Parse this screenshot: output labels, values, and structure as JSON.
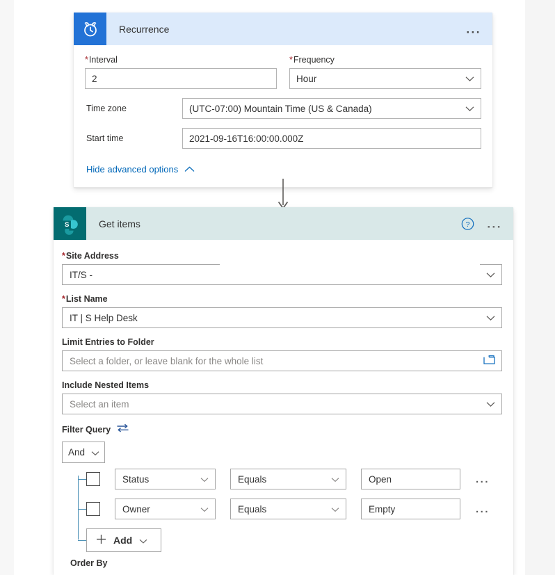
{
  "recurrence": {
    "title": "Recurrence",
    "icon": "alarm-clock-icon",
    "menu_label": "...",
    "fields": {
      "interval_label": "Interval",
      "interval_value": "2",
      "frequency_label": "Frequency",
      "frequency_value": "Hour",
      "timezone_label": "Time zone",
      "timezone_value": "(UTC-07:00) Mountain Time (US & Canada)",
      "starttime_label": "Start time",
      "starttime_value": "2021-09-16T16:00:00.000Z"
    },
    "advanced_link": "Hide advanced options",
    "required_marker": "*"
  },
  "getitems": {
    "title": "Get items",
    "icon": "sharepoint-icon",
    "help_label": "?",
    "menu_label": "...",
    "site_address_label": "Site Address",
    "site_address_value": "IT/S -",
    "list_name_label": "List Name",
    "list_name_value": "IT | S Help Desk",
    "limit_folder_label": "Limit Entries to Folder",
    "limit_folder_placeholder": "Select a folder, or leave blank for the whole list",
    "folder_icon": "folder-picker-icon",
    "nested_items_label": "Include Nested Items",
    "nested_items_placeholder": "Select an item",
    "filter_query_label": "Filter Query",
    "swap_icon": "swap-arrows-icon",
    "conjunction_value": "And",
    "conditions": [
      {
        "field": "Status",
        "operator": "Equals",
        "value": "Open",
        "menu": "..."
      },
      {
        "field": "Owner",
        "operator": "Equals",
        "value": "Empty",
        "menu": "..."
      }
    ],
    "add_button_label": "Add",
    "order_by_label": "Order By",
    "required_marker": "*"
  },
  "colors": {
    "recurrence_header": "#dceafb",
    "recurrence_icon": "#2272d6",
    "getitems_header": "#d9e8e8",
    "getitems_icon": "#036c70",
    "link_blue": "#0067b8",
    "required_red": "#a4262c",
    "rail_blue": "#4a8fb5",
    "page_background": "#f5f5f5"
  }
}
